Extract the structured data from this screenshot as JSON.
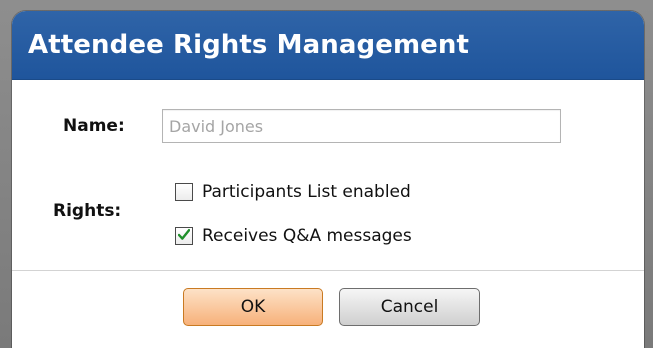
{
  "dialog": {
    "title": "Attendee Rights Management",
    "colors": {
      "titlebar": "#2b60a6",
      "title_text": "#ffffff",
      "ok_button": "#f9c39a",
      "cancel_button": "#dedede",
      "check_mark": "#1f8f2a"
    }
  },
  "form": {
    "name_label": "Name:",
    "name_placeholder": "David Jones",
    "name_value": "",
    "rights_label": "Rights:",
    "rights": [
      {
        "label": "Participants List enabled",
        "checked": false,
        "icon": "checkbox-unchecked-icon"
      },
      {
        "label": "Receives Q&A messages",
        "checked": true,
        "icon": "checkmark-icon"
      }
    ]
  },
  "buttons": {
    "ok_label": "OK",
    "cancel_label": "Cancel"
  }
}
